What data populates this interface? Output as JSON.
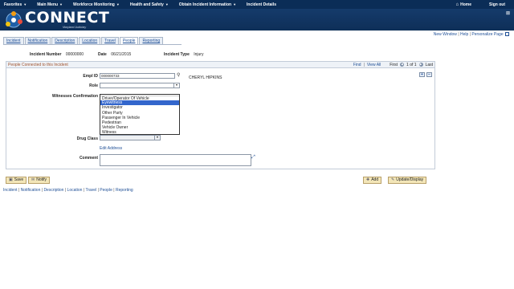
{
  "topnav": {
    "items": [
      "Favorites",
      "Main Menu",
      "Workforce Monitoring",
      "Health and Safety",
      "Obtain Incident Information",
      "Incident Details"
    ],
    "home": "Home",
    "signout": "Sign out"
  },
  "banner": {
    "brand": "CONNECT",
    "sub": "Maryland Judiciary"
  },
  "utility": {
    "new_window": "New Window",
    "help": "Help",
    "personalize": "Personalize Page"
  },
  "tabs": [
    "Incident",
    "Notification",
    "Description",
    "Location",
    "Travel",
    "People",
    "Reporting"
  ],
  "active_tab": "People",
  "header": {
    "incident_number_label": "Incident Number",
    "incident_number": "00000000",
    "date_label": "Date",
    "date": "06/21/2015",
    "incident_type_label": "Incident Type",
    "incident_type": "Injury"
  },
  "grid": {
    "title": "People Connected to this Incident",
    "find": "Find",
    "view_all": "View All",
    "first": "First",
    "counter": "1 of 1",
    "last": "Last"
  },
  "form": {
    "empl_id_label": "Empl ID",
    "empl_id_value": "000000733",
    "empl_name": "CHERYL HIPKINS",
    "role_label": "Role",
    "role_value": "",
    "witness_label": "Witnesses Confirmation",
    "drug_class_label": "Drug Class",
    "edit_address": "Edit Address",
    "comment_label": "Comment"
  },
  "role_options": [
    "Driver/Operator Of Vehicle",
    "Eyewitness",
    "Investigator",
    "Other Party",
    "Passenger In Vehicle",
    "Pedestrian",
    "Vehicle Owner",
    "Witness"
  ],
  "role_selected_index": 1,
  "buttons": {
    "save": "Save",
    "notify": "Notify",
    "add": "Add",
    "update": "Update/Display"
  },
  "footer": [
    "Incident",
    "Notification",
    "Description",
    "Location",
    "Travel",
    "People",
    "Reporting"
  ]
}
